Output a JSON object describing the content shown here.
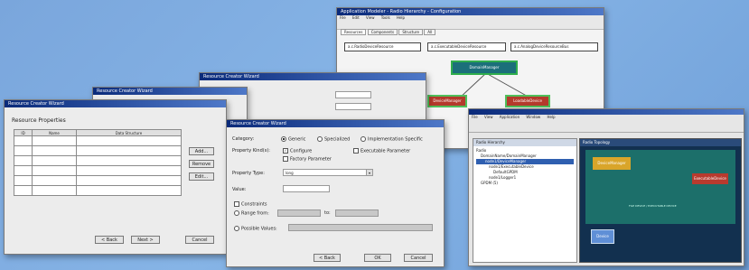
{
  "wizard_back2": {
    "title": "Resource Creator Wizard"
  },
  "wizard_back3": {
    "title": "Resource Creator Wizard"
  },
  "wizard_props": {
    "title": "Resource Creator Wizard",
    "heading": "Resource Properties",
    "columns": [
      "ID",
      "Name",
      "Data Structure"
    ],
    "buttons": {
      "add": "Add...",
      "remove": "Remove",
      "edit": "Edit..."
    },
    "nav": {
      "back": "< Back",
      "next": "Next >",
      "cancel": "Cancel"
    }
  },
  "wizard_main": {
    "title": "Resource Creator Wizard",
    "category_label": "Category:",
    "category_options": [
      "Generic",
      "Specialized",
      "Implementation Specific"
    ],
    "property_kinds_label": "Property Kind(s):",
    "kind_configure": "Configure",
    "kind_factory": "Factory Parameter",
    "kind_executable": "Executable Parameter",
    "property_type_label": "Property Type:",
    "property_type_value": "long",
    "value_label": "Value:",
    "constraints_label": "Constraints",
    "range_from_label": "Range from:",
    "range_to_label": "to:",
    "possible_values_label": "Possible Values:",
    "nav": {
      "back": "< Back",
      "ok": "OK",
      "cancel": "Cancel"
    }
  },
  "diagram_window": {
    "title": "Application Modeler - Radio Hierarchy - Configuration",
    "menu": [
      "File",
      "Edit",
      "View",
      "Tools",
      "Help"
    ],
    "tabs": [
      "Resources",
      "Components",
      "Structure",
      "All"
    ],
    "components": [
      "a.c.RadioDeviceResource",
      "a.c.ExecutableDeviceResource",
      "a.c.AnalogDeviceResourceBus"
    ],
    "nodes": [
      "DomainManager",
      "DeviceManager",
      "LoadableDevice"
    ]
  },
  "topology_window": {
    "title": "Radio Topology",
    "menu": [
      "File",
      "View",
      "Application",
      "Window",
      "Help"
    ],
    "hierarchy_panel_title": "Radio Hierarchy",
    "tree": [
      "Radio",
      "DomainName/DomainManager",
      "node1/DeviceManager",
      "node1/ExecutableDevice",
      "DefaultGPDM",
      "node1/Logger1",
      "GPDM (5)"
    ],
    "topology_panel_title": "Radio Topology",
    "topology_nodes": [
      "DeviceManager",
      "ExecutableDevice",
      "Device"
    ],
    "link_label": "FILE DEVICE / EXECUTABLE DEVICE"
  }
}
